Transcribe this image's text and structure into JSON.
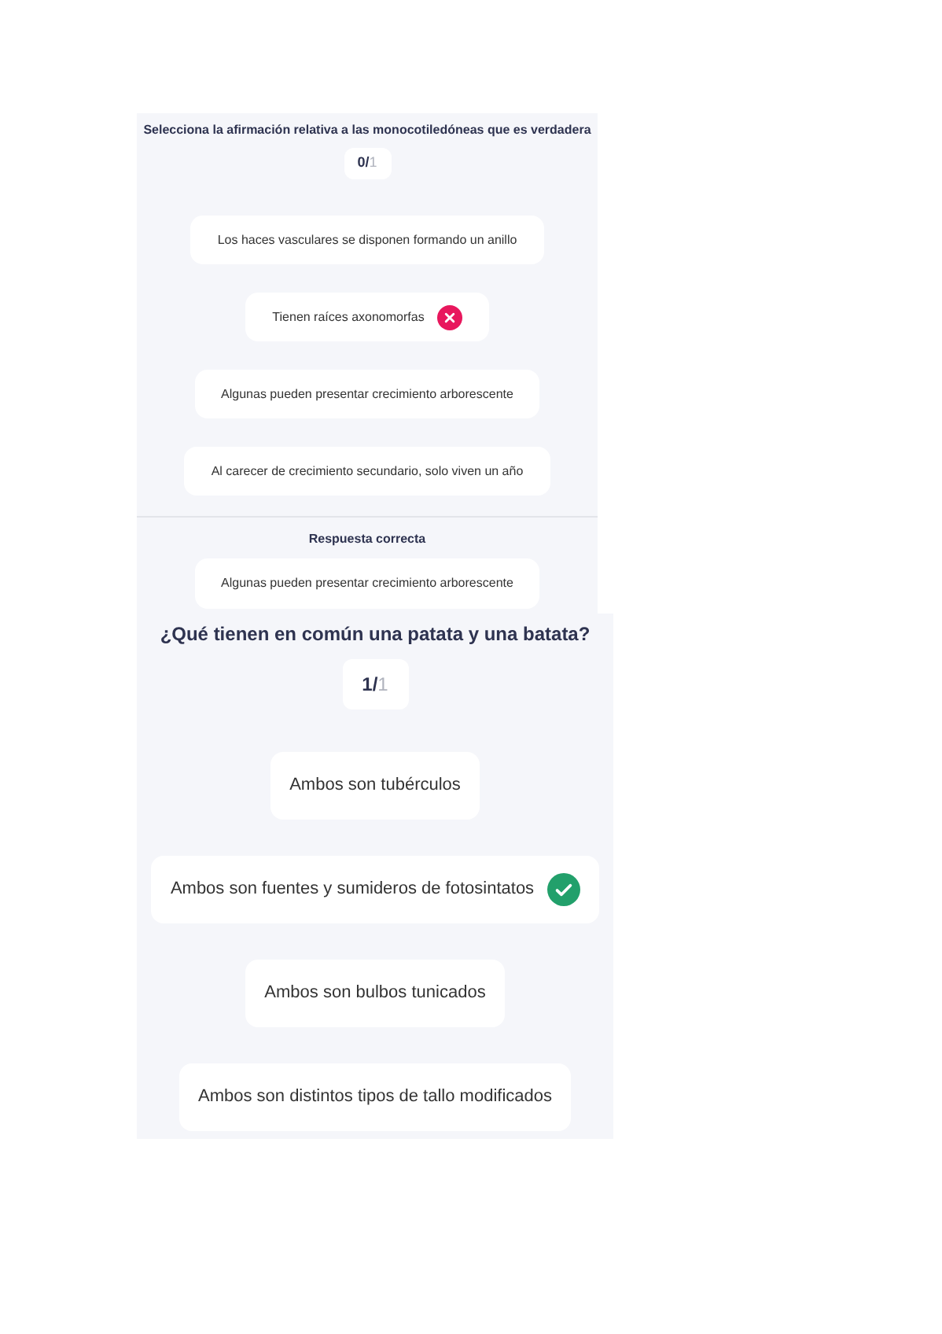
{
  "quizzes": [
    {
      "question": "Selecciona la afirmación relativa a las monocotiledóneas que es verdadera",
      "score": "0/",
      "total": "1",
      "options": [
        {
          "text": "Los haces vasculares se disponen formando un anillo",
          "selected": false
        },
        {
          "text": "Tienen raíces axonomorfas",
          "selected": true,
          "correct": false
        },
        {
          "text": "Algunas pueden presentar crecimiento arborescente",
          "selected": false
        },
        {
          "text": "Al carecer de crecimiento secundario, solo viven un año",
          "selected": false
        }
      ],
      "correct_heading": "Respuesta correcta",
      "correct_answer": "Algunas pueden presentar crecimiento arborescente"
    },
    {
      "question": "¿Qué tienen en común una patata y una batata?",
      "score": "1/",
      "total": "1",
      "options": [
        {
          "text": "Ambos son tubérculos",
          "selected": false
        },
        {
          "text": "Ambos son fuentes y sumideros de fotosintatos",
          "selected": true,
          "correct": true
        },
        {
          "text": "Ambos son bulbos tunicados",
          "selected": false
        },
        {
          "text": "Ambos son distintos tipos de tallo modificados",
          "selected": false
        }
      ]
    }
  ]
}
